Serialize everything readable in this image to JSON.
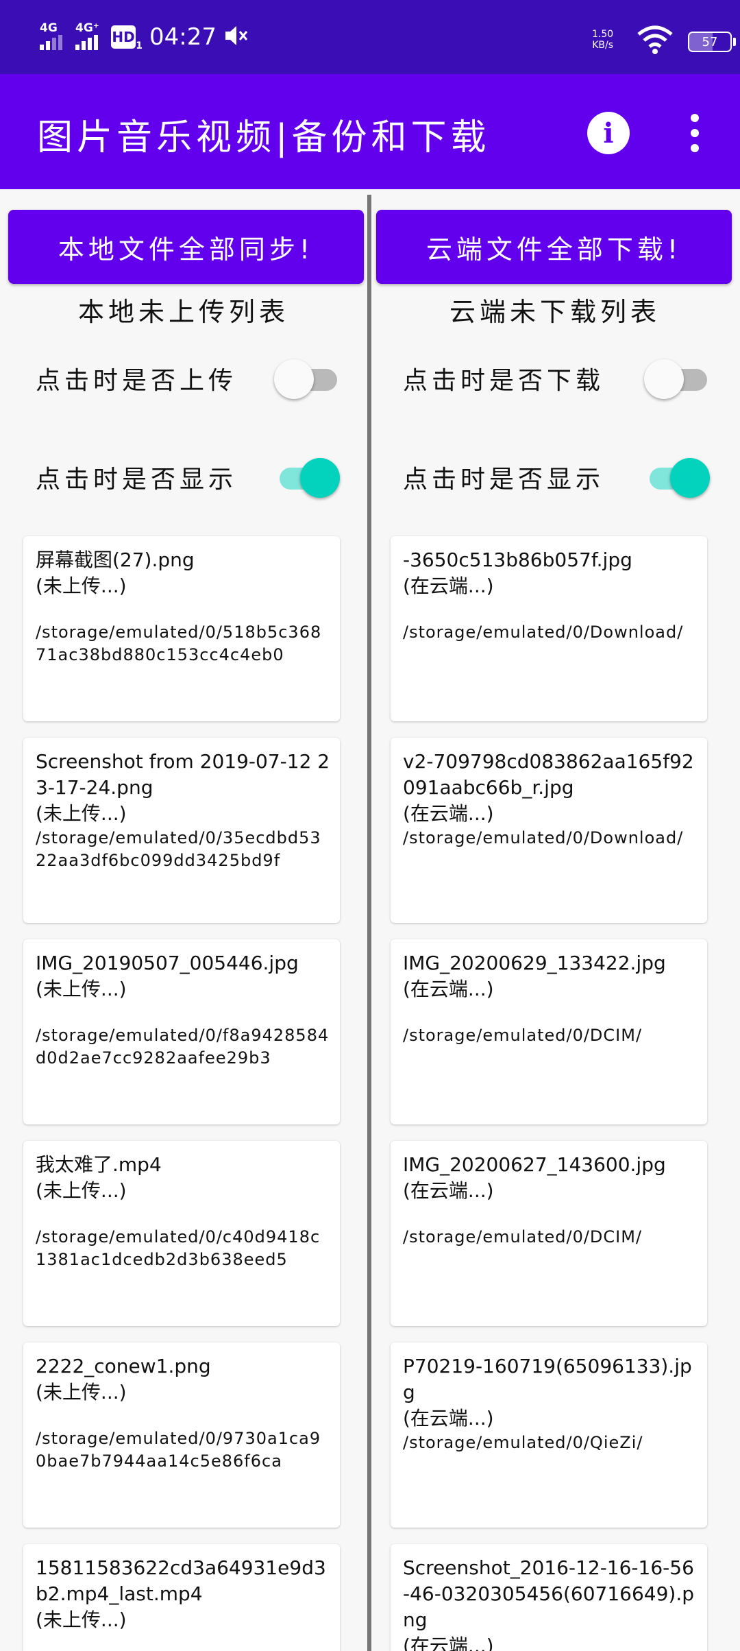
{
  "status_bar": {
    "net1": "4G",
    "net2": "4G⁺",
    "hd": "HD",
    "hd_sub": "1",
    "time": "04:27",
    "speed_value": "1.50",
    "speed_unit": "KB/s",
    "battery": "57",
    "battery_level": 0.57
  },
  "app_bar": {
    "title": "图片音乐视频|备份和下载",
    "info_icon": "info-icon",
    "more_icon": "more-vert-icon"
  },
  "left": {
    "sync_button": "本地文件全部同步!",
    "title": "本地未上传列表",
    "toggle_upload": {
      "label": "点击时是否上传",
      "on": false
    },
    "toggle_show": {
      "label": "点击时是否显示",
      "on": true
    },
    "files": [
      {
        "name": "屏幕截图(27).png",
        "status": "(未上传...)",
        "path": "/storage/emulated/0/518b5c36871ac38bd880c153cc4c4eb0"
      },
      {
        "name": "Screenshot from 2019-07-12 23-17-24.png",
        "status": "(未上传...)",
        "path": "/storage/emulated/0/35ecdbd5322aa3df6bc099dd3425bd9f"
      },
      {
        "name": "IMG_20190507_005446.jpg",
        "status": "(未上传...)",
        "path": "/storage/emulated/0/f8a9428584d0d2ae7cc9282aafee29b3"
      },
      {
        "name": "我太难了.mp4",
        "status": "(未上传...)",
        "path": "/storage/emulated/0/c40d9418c1381ac1dcedb2d3b638eed5"
      },
      {
        "name": "2222_conew1.png",
        "status": "(未上传...)",
        "path": "/storage/emulated/0/9730a1ca90bae7b7944aa14c5e86f6ca"
      },
      {
        "name": "15811583622cd3a64931e9d3b2.mp4_last.mp4",
        "status": "(未上传...)",
        "path": ""
      }
    ]
  },
  "right": {
    "sync_button": "云端文件全部下载!",
    "title": "云端未下载列表",
    "toggle_download": {
      "label": "点击时是否下载",
      "on": false
    },
    "toggle_show": {
      "label": "点击时是否显示",
      "on": true
    },
    "files": [
      {
        "name": "-3650c513b86b057f.jpg",
        "status": "(在云端...)",
        "path": "/storage/emulated/0/Download/"
      },
      {
        "name": "v2-709798cd083862aa165f92091aabc66b_r.jpg",
        "status": "(在云端...)",
        "path": "/storage/emulated/0/Download/"
      },
      {
        "name": "IMG_20200629_133422.jpg",
        "status": "(在云端...)",
        "path": "/storage/emulated/0/DCIM/"
      },
      {
        "name": "IMG_20200627_143600.jpg",
        "status": "(在云端...)",
        "path": "/storage/emulated/0/DCIM/"
      },
      {
        "name": "P70219-160719(65096133).jpg",
        "status": "(在云端...)",
        "path": "/storage/emulated/0/QieZi/"
      },
      {
        "name": "Screenshot_2016-12-16-16-56-46-0320305456(60716649).png",
        "status": "(在云端...)",
        "path": ""
      }
    ]
  }
}
